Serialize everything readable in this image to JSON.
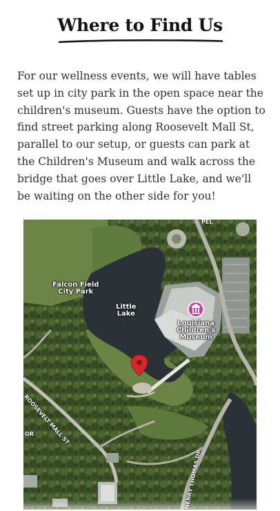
{
  "section": {
    "heading": "Where to Find Us",
    "paragraph": "For our wellness events, we will have tables set up in city park in the open space near the children's museum. Guests have the option to find street parking along Roosevelt Mall St, parallel to our setup, or guests can park at the Children's Museum and walk across the bridge that goes over Little Lake, and we'll be waiting on the other side for you!"
  },
  "map": {
    "labels": {
      "falcon_field_line1": "Falcon Field",
      "falcon_field_line2": "City Park",
      "little_lake_line1": "Little",
      "little_lake_line2": "Lake",
      "museum_line1": "Louisiana",
      "museum_line2": "Children's",
      "museum_line3": "Museum",
      "roosevelt_mall": "ROOSEVELT MALL ST",
      "henry_thomas": "HENRY THOMAS DR",
      "edge_text_left": "OR",
      "edge_text_top": "PEL"
    },
    "icons": {
      "location_pin": "location-pin-icon",
      "museum": "museum-icon"
    },
    "colors": {
      "pin": "#d4282c",
      "museum_badge": "#c2409a",
      "water": "#2a3136",
      "grass": "#5d7a3a",
      "trees": "#3b4f27"
    }
  }
}
